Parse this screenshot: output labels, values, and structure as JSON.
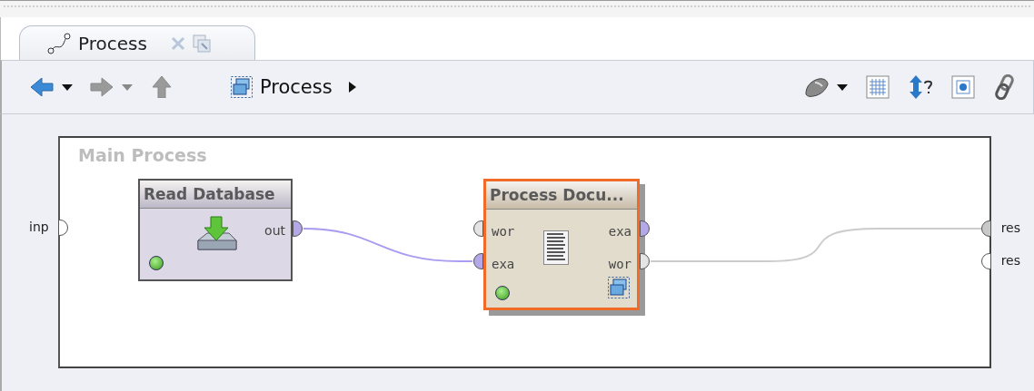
{
  "tab": {
    "label": "Process"
  },
  "toolbar": {
    "nav": [
      {
        "kind": "back",
        "disabled": false
      },
      {
        "kind": "forward",
        "disabled": true
      },
      {
        "kind": "up",
        "disabled": true
      }
    ],
    "breadcrumb": "Process"
  },
  "canvas": {
    "title": "Main Process",
    "inputs": [
      {
        "label": "inp",
        "color": "#ffffff"
      }
    ],
    "outputs": [
      {
        "label": "res",
        "color": "#c8c8c8"
      },
      {
        "label": "res",
        "color": "#ffffff"
      }
    ],
    "operators": [
      {
        "title": "Read Database",
        "selected": false,
        "kind": "read",
        "outputs": [
          {
            "label": "out",
            "color": "#b4a8e8"
          }
        ]
      },
      {
        "title": "Process Docu...",
        "selected": true,
        "kind": "document",
        "inputs": [
          {
            "label": "wor",
            "color": "#e4e4e4"
          },
          {
            "label": "exa",
            "color": "#b4a8e8"
          }
        ],
        "outputs": [
          {
            "label": "exa",
            "color": "#b4a8e8"
          },
          {
            "label": "wor",
            "color": "#e4e4e4"
          }
        ]
      }
    ],
    "connections": [
      {
        "color": "#a99cf0"
      },
      {
        "color": "#cccccc"
      }
    ]
  }
}
